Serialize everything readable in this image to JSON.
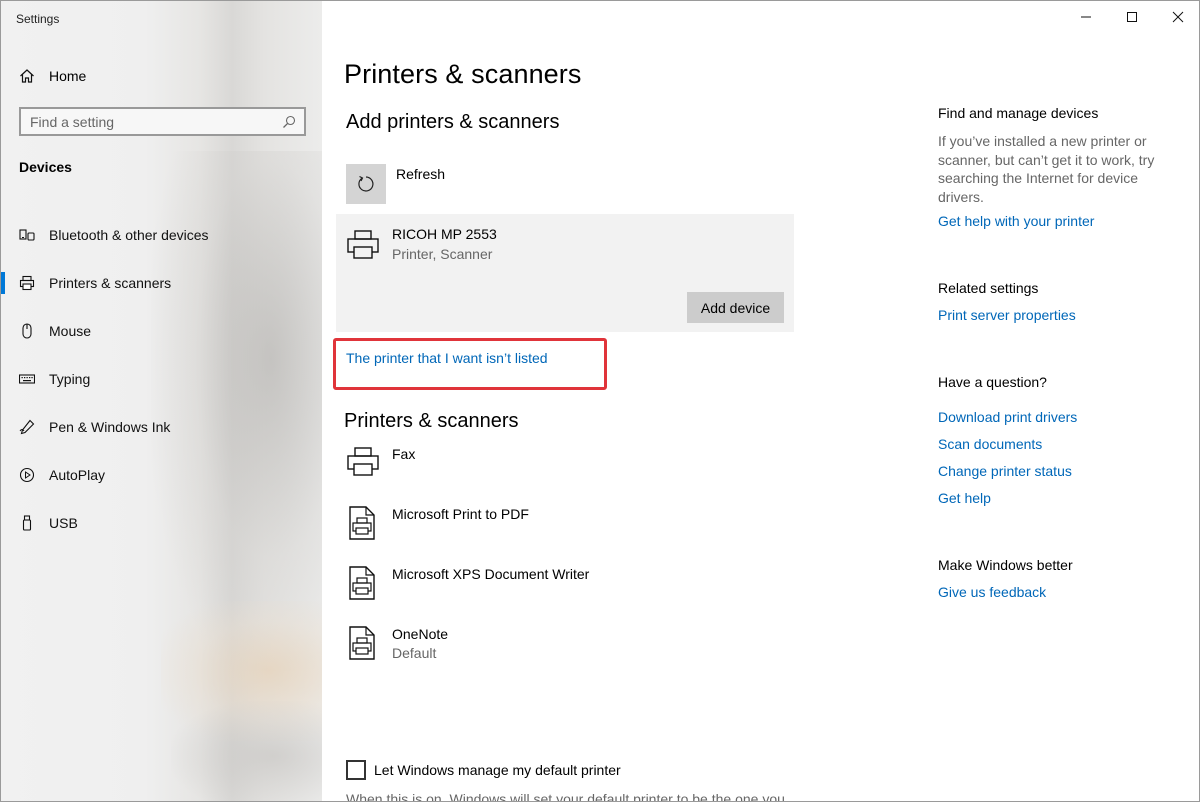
{
  "window": {
    "app_title": "Settings"
  },
  "sidebar": {
    "home_label": "Home",
    "search_placeholder": "Find a setting",
    "section_title": "Devices",
    "items": [
      {
        "label": "Bluetooth & other devices",
        "icon": "bluetooth-icon",
        "active": false
      },
      {
        "label": "Printers & scanners",
        "icon": "printer-icon",
        "active": true
      },
      {
        "label": "Mouse",
        "icon": "mouse-icon",
        "active": false
      },
      {
        "label": "Typing",
        "icon": "keyboard-icon",
        "active": false
      },
      {
        "label": "Pen & Windows Ink",
        "icon": "pen-icon",
        "active": false
      },
      {
        "label": "AutoPlay",
        "icon": "autoplay-icon",
        "active": false
      },
      {
        "label": "USB",
        "icon": "usb-icon",
        "active": false
      }
    ]
  },
  "main": {
    "page_title": "Printers & scanners",
    "add_section_title": "Add printers & scanners",
    "refresh_label": "Refresh",
    "found_device": {
      "name": "RICOH MP 2553",
      "type": "Printer, Scanner",
      "add_button": "Add device"
    },
    "not_listed_link": "The printer that I want isn’t listed",
    "list_section_title": "Printers & scanners",
    "printers": [
      {
        "name": "Fax",
        "status": "",
        "icon": "printer-icon"
      },
      {
        "name": "Microsoft Print to PDF",
        "status": "",
        "icon": "document-printer-icon"
      },
      {
        "name": "Microsoft XPS Document Writer",
        "status": "",
        "icon": "document-printer-icon"
      },
      {
        "name": "OneNote",
        "status": "Default",
        "icon": "document-printer-icon"
      }
    ],
    "manage_default": {
      "label": "Let Windows manage my default printer",
      "checked": false,
      "description": "When this is on, Windows will set your default printer to be the one you"
    }
  },
  "right_panel": {
    "find_manage": {
      "heading": "Find and manage devices",
      "text": "If you’ve installed a new printer or scanner, but can’t get it to work, try searching the Internet for device drivers.",
      "link": "Get help with your printer"
    },
    "related": {
      "heading": "Related settings",
      "link": "Print server properties"
    },
    "question": {
      "heading": "Have a question?",
      "links": [
        "Download print drivers",
        "Scan documents",
        "Change printer status",
        "Get help"
      ]
    },
    "better": {
      "heading": "Make Windows better",
      "link": "Give us feedback"
    }
  },
  "colors": {
    "accent": "#0078d7",
    "link": "#0067b8",
    "highlight": "#e0343a"
  }
}
